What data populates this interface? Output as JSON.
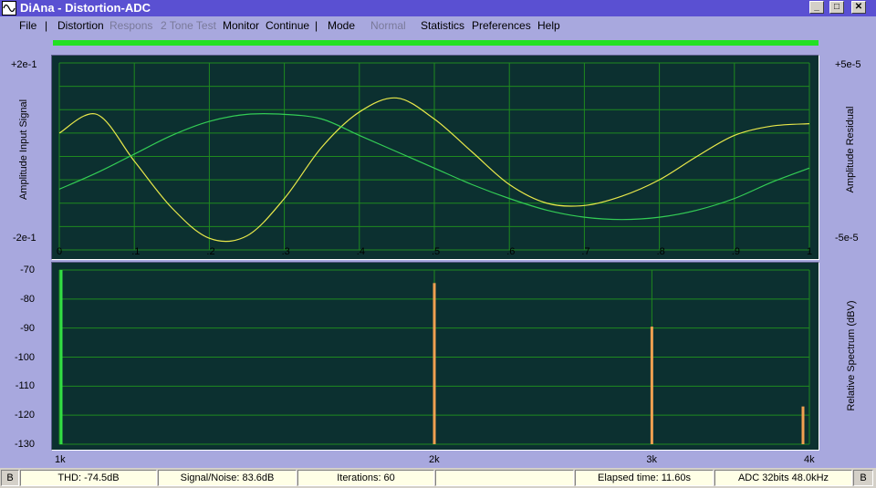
{
  "window": {
    "title": "DiAna - Distortion-ADC",
    "minimize": "_",
    "maximize": "□",
    "close": "✕"
  },
  "menu": {
    "items": [
      {
        "label": "File",
        "enabled": true
      },
      {
        "label": "Distortion",
        "enabled": true
      },
      {
        "label": "Respons",
        "enabled": false
      },
      {
        "label": "2 Tone Test",
        "enabled": false
      },
      {
        "label": "Monitor",
        "enabled": true
      },
      {
        "label": "Continue",
        "enabled": true
      },
      {
        "label": "Mode",
        "enabled": true
      },
      {
        "label": "Normal",
        "enabled": false
      },
      {
        "label": "Statistics",
        "enabled": true
      },
      {
        "label": "Preferences",
        "enabled": true
      },
      {
        "label": "Help",
        "enabled": true
      }
    ],
    "separator": "|"
  },
  "progress": {
    "fraction": 1.0,
    "color": "#23e023"
  },
  "colors": {
    "plot_bg": "#0c3030",
    "grid": "#1f8a1f",
    "signal": "#e8e84a",
    "residual": "#33cc55",
    "fundamental": "#33dd44",
    "harmonic": "#f0a050"
  },
  "chart_data": [
    {
      "type": "line",
      "xlim": [
        0,
        1
      ],
      "x_ticks": [
        "0",
        ".1",
        ".2",
        ".3",
        ".4",
        ".5",
        ".6",
        ".7",
        ".8",
        ".9",
        "1"
      ],
      "ylabel_left": "Amplitude Input Signal",
      "ylabel_right": "Amplitude Residual",
      "left_ylim_labels": [
        "+2e-1",
        "-2e-1"
      ],
      "right_ylim_labels": [
        "+5e-5",
        "-5e-5"
      ],
      "grid": true,
      "series": [
        {
          "color": "#e8e84a",
          "x": [
            0,
            0.05,
            0.1,
            0.15,
            0.2,
            0.25,
            0.3,
            0.35,
            0.4,
            0.45,
            0.5,
            0.55,
            0.6,
            0.65,
            0.7,
            0.75,
            0.8,
            0.85,
            0.9,
            0.95,
            1
          ],
          "y": [
            0.5,
            0.9,
            -0.1,
            -1.1,
            -1.75,
            -1.7,
            -0.9,
            0.2,
            0.95,
            1.25,
            0.8,
            0.1,
            -0.6,
            -1.0,
            -1.05,
            -0.85,
            -0.5,
            0.0,
            0.45,
            0.65,
            0.7
          ]
        },
        {
          "color": "#33cc55",
          "x": [
            0,
            0.05,
            0.1,
            0.15,
            0.2,
            0.25,
            0.3,
            0.35,
            0.4,
            0.45,
            0.5,
            0.55,
            0.6,
            0.65,
            0.7,
            0.75,
            0.8,
            0.85,
            0.9,
            0.95,
            1
          ],
          "y": [
            -0.7,
            -0.35,
            0.05,
            0.45,
            0.75,
            0.9,
            0.9,
            0.8,
            0.45,
            0.1,
            -0.25,
            -0.6,
            -0.9,
            -1.15,
            -1.3,
            -1.35,
            -1.3,
            -1.15,
            -0.9,
            -0.55,
            -0.25
          ]
        }
      ]
    },
    {
      "type": "bar",
      "ylabel": "Relative Spectrum  (dBV)",
      "ylim": [
        -130,
        -70
      ],
      "y_ticks": [
        "-70",
        "-80",
        "-90",
        "-100",
        "-110",
        "-120",
        "-130"
      ],
      "x_ticks": [
        "1k",
        "2k",
        "3k",
        "4k"
      ],
      "xlim": [
        1000,
        4000
      ],
      "bars": [
        {
          "x": 1000,
          "value": -70,
          "color": "#33dd44"
        },
        {
          "x": 2000,
          "value": -74.5,
          "color": "#f0a050"
        },
        {
          "x": 3000,
          "value": -89.5,
          "color": "#f0a050"
        },
        {
          "x": 4000,
          "value": -117,
          "color": "#f0a050"
        }
      ]
    }
  ],
  "status": {
    "left_mode": "B",
    "thd": "THD:  -74.5dB",
    "snr": "Signal/Noise:   83.6dB",
    "iterations": "Iterations: 60",
    "blank": "",
    "elapsed": "Elapsed time: 11.60s",
    "adc": "ADC 32bits 48.0kHz",
    "right_mode": "B"
  }
}
